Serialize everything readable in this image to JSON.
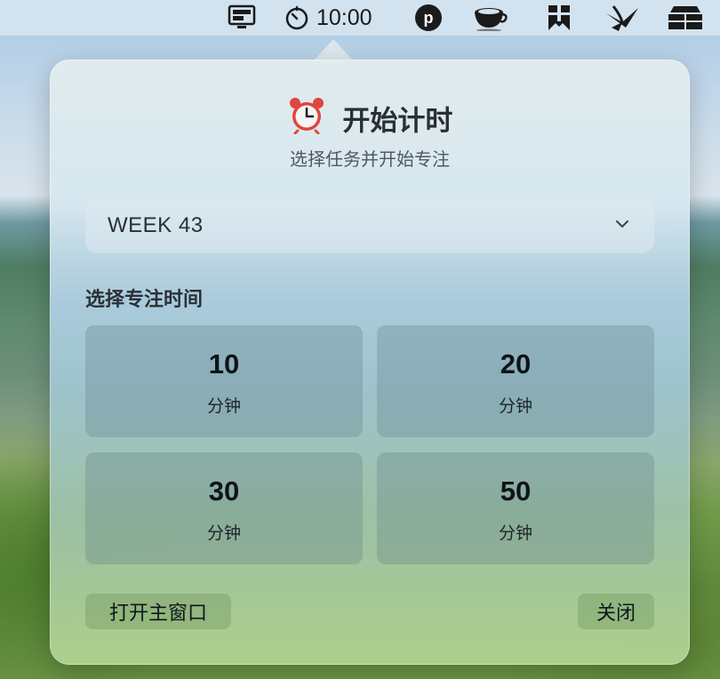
{
  "menubar": {
    "icons": [
      "monitor-icon",
      "timer-icon",
      "p-circle-icon",
      "coffee-cup-icon",
      "bookmark-app-icon",
      "paper-plane-icon",
      "stack-icon"
    ],
    "time": "10:00",
    "p_letter": "p"
  },
  "popover": {
    "title_icon": "alarm-clock-icon",
    "title": "开始计时",
    "subtitle": "选择任务并开始专注",
    "task_select": {
      "value": "WEEK 43"
    },
    "duration_label": "选择专注时间",
    "durations": [
      {
        "minutes": "10",
        "unit": "分钟"
      },
      {
        "minutes": "20",
        "unit": "分钟"
      },
      {
        "minutes": "30",
        "unit": "分钟"
      },
      {
        "minutes": "50",
        "unit": "分钟"
      }
    ],
    "open_main_window": "打开主窗口",
    "close": "关闭"
  }
}
